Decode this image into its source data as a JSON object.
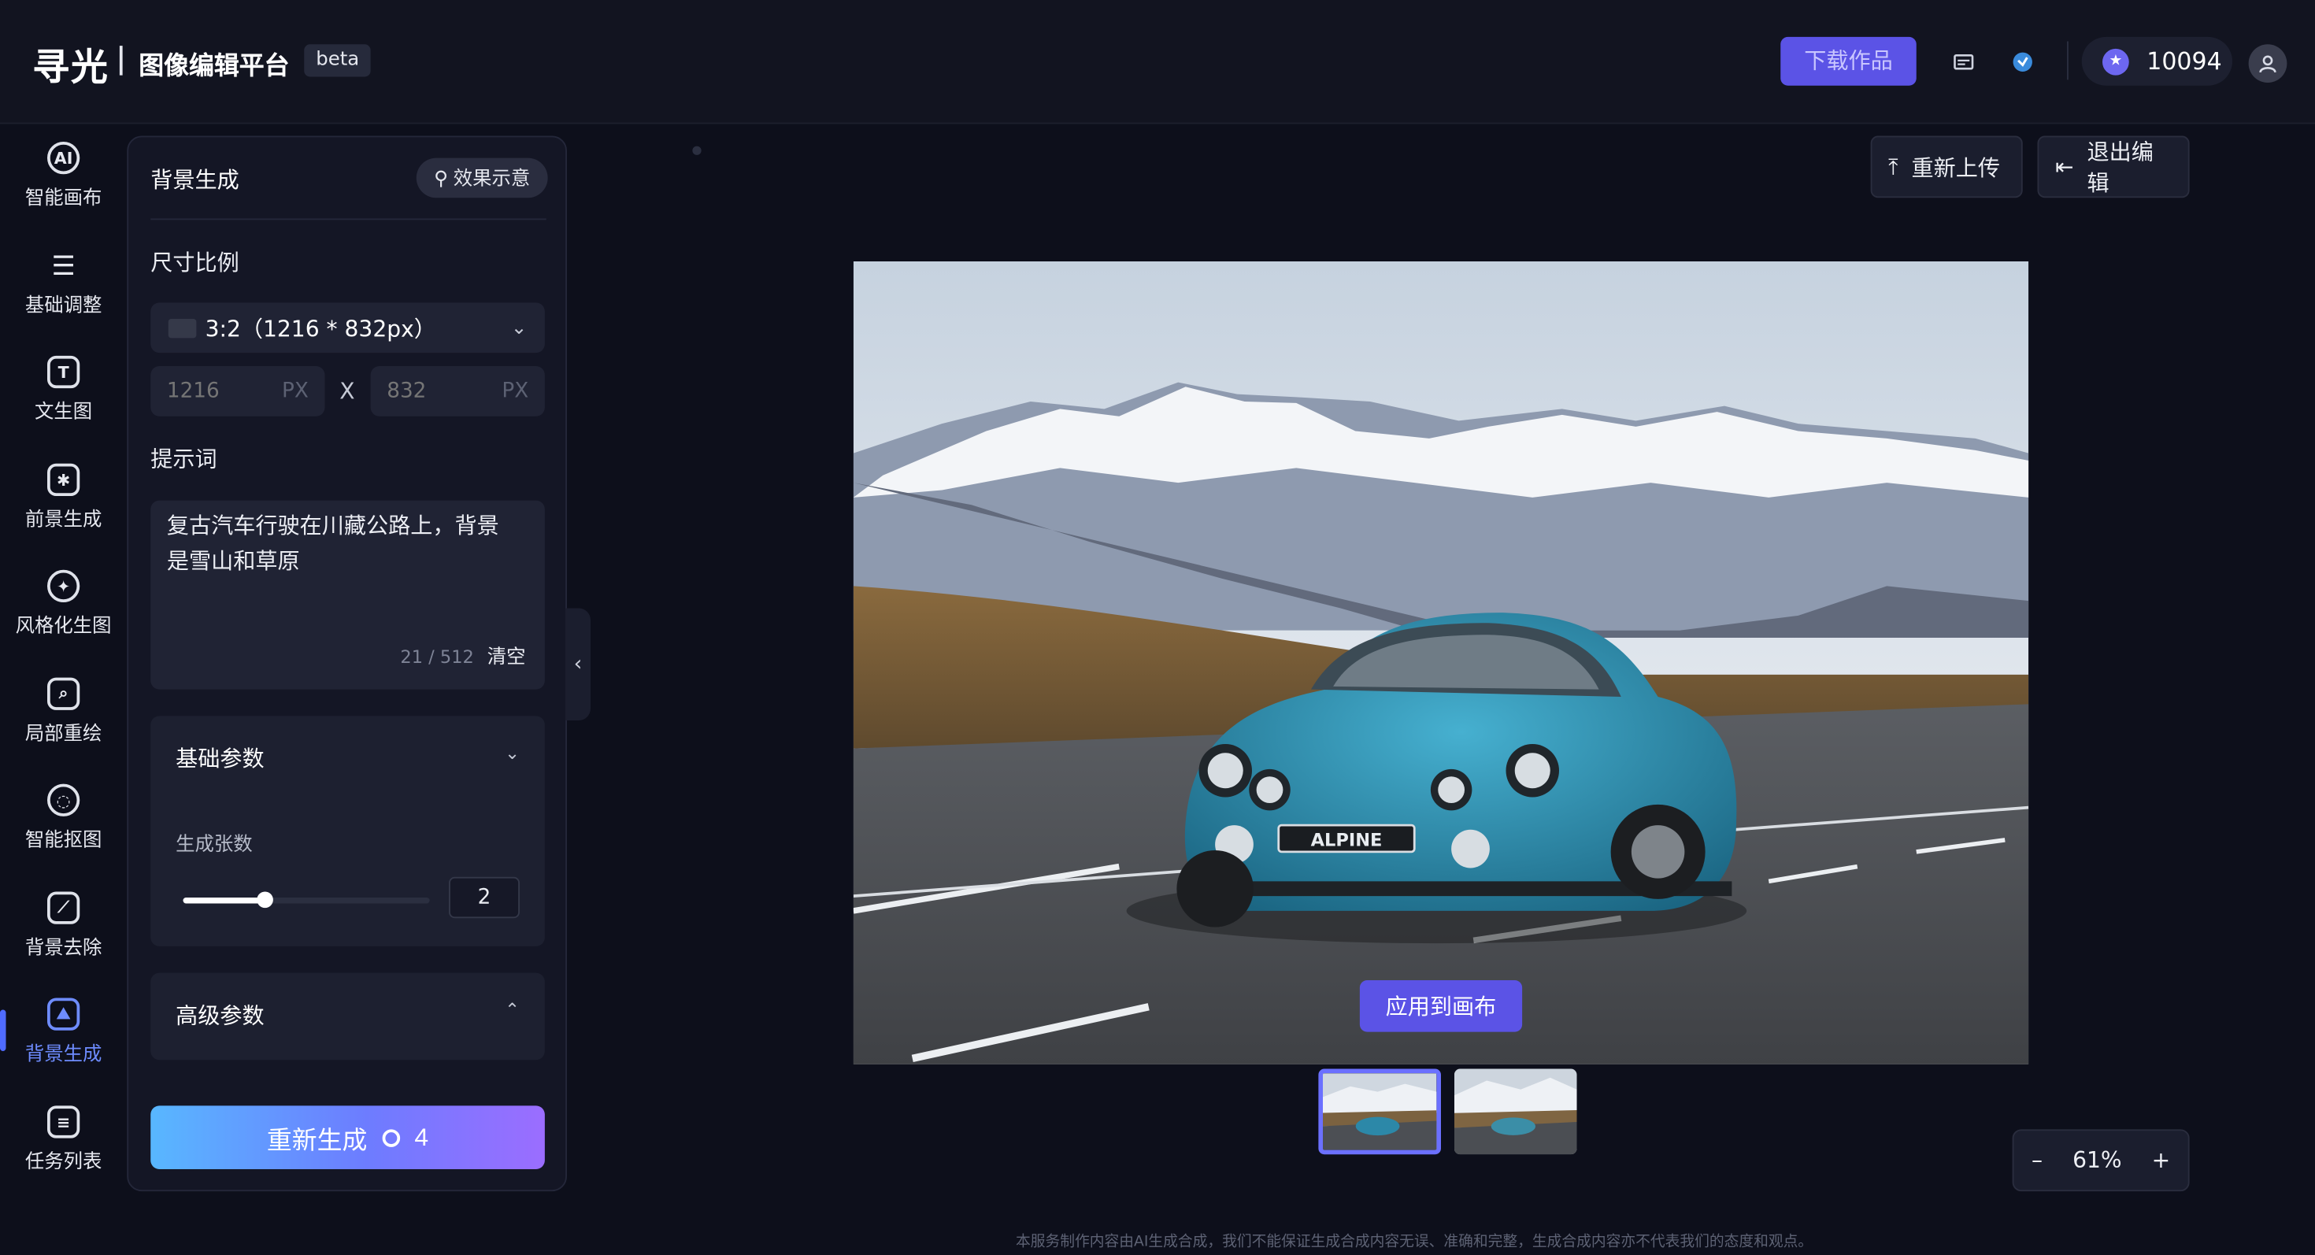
{
  "app": {
    "logo_text": "寻光",
    "platform_name": "图像编辑平台",
    "badge": "beta"
  },
  "header": {
    "download_label": "下载作品",
    "credits": "10094",
    "icons": [
      "id-card-icon",
      "sphere-icon"
    ]
  },
  "rail": {
    "items": [
      {
        "label": "智能画布",
        "icon": "ai-icon"
      },
      {
        "label": "基础调整",
        "icon": "sliders-icon"
      },
      {
        "label": "文生图",
        "icon": "text-icon"
      },
      {
        "label": "前景生成",
        "icon": "spark-icon"
      },
      {
        "label": "风格化生图",
        "icon": "style-icon"
      },
      {
        "label": "局部重绘",
        "icon": "brush-icon"
      },
      {
        "label": "智能抠图",
        "icon": "cutout-icon"
      },
      {
        "label": "背景去除",
        "icon": "eraser-icon"
      },
      {
        "label": "背景生成",
        "icon": "image-icon",
        "active": true
      },
      {
        "label": "任务列表",
        "icon": "list-icon"
      }
    ]
  },
  "panel": {
    "title": "背景生成",
    "demo_label": "效果示意",
    "size_label": "尺寸比例",
    "ratio": "3:2（1216 * 832px）",
    "width_placeholder": "1216",
    "height_placeholder": "832",
    "unit": "PX",
    "x_sep": "X",
    "prompt_label": "提示词",
    "prompt_text": "复古汽车行驶在川藏公路上，背景是雪山和草原",
    "prompt_count": "21 / 512",
    "clear_label": "清空",
    "basic": {
      "title": "基础参数",
      "count_label": "生成张数",
      "count_value": "2",
      "slider_fraction": 0.33
    },
    "advanced": {
      "title": "高级参数"
    },
    "generate_label": "重新生成",
    "generate_cost": "4"
  },
  "canvas": {
    "reupload_label": "重新上传",
    "exit_label": "退出编辑",
    "apply_label": "应用到画布",
    "plate_text": "ALPINE",
    "zoom": "61%",
    "minus": "–",
    "plus": "+"
  },
  "footer": {
    "disclaimer": "本服务制作内容由AI生成合成，我们不能保证生成合成内容无误、准确和完整，生成合成内容亦不代表我们的态度和观点。"
  }
}
